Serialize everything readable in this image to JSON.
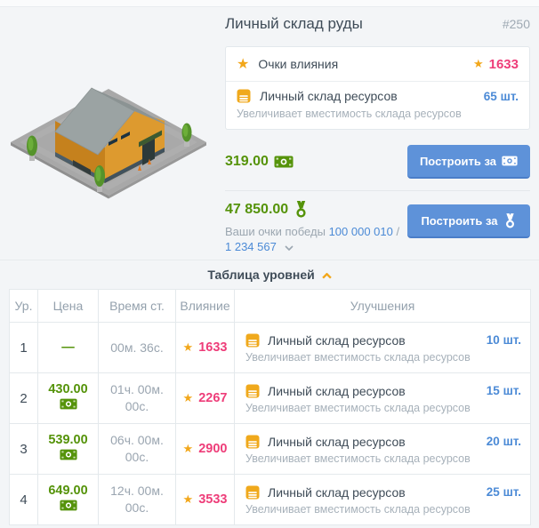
{
  "colors": {
    "accent_blue": "#5e92d9",
    "link_blue": "#4b8ad6",
    "money_green": "#55930a",
    "influence_pink": "#ee3d79",
    "gold": "#f2a71b",
    "gray_text": "#9ba6b0",
    "dark_text": "#3f4c58",
    "background": "#f3f5f7"
  },
  "header": {
    "title": "Личный склад руды",
    "building_number": "#250"
  },
  "info_box": {
    "influence": {
      "label": "Очки влияния",
      "value": "1633"
    },
    "storage": {
      "label": "Личный склад ресурсов",
      "count": "65 шт.",
      "description": "Увеличивает вместимость склада ресурсов"
    }
  },
  "purchase": {
    "money": {
      "price": "319.00",
      "button_label": "Построить за"
    },
    "medals": {
      "price": "47 850.00",
      "button_label": "Построить за",
      "victory_points_label": "Ваши очки победы",
      "victory_points_current": "100 000 010",
      "separator": "/",
      "victory_points_required": "1 234 567"
    }
  },
  "levels_section": {
    "title": "Таблица уровней",
    "columns": [
      "Ур.",
      "Цена",
      "Время ст.",
      "Влияние",
      "Улучшения"
    ],
    "rows": [
      {
        "level": "1",
        "price": "—",
        "price_icon": false,
        "time": "00м. 36с.",
        "influence": "1633",
        "upgrade_name": "Личный склад ресурсов",
        "upgrade_count": "10 шт.",
        "upgrade_desc": "Увеличивает вместимость склада ресурсов"
      },
      {
        "level": "2",
        "price": "430.00",
        "price_icon": true,
        "time": "01ч. 00м. 00с.",
        "influence": "2267",
        "upgrade_name": "Личный склад ресурсов",
        "upgrade_count": "15 шт.",
        "upgrade_desc": "Увеличивает вместимость склада ресурсов"
      },
      {
        "level": "3",
        "price": "539.00",
        "price_icon": true,
        "time": "06ч. 00м. 00с.",
        "influence": "2900",
        "upgrade_name": "Личный склад ресурсов",
        "upgrade_count": "20 шт.",
        "upgrade_desc": "Увеличивает вместимость склада ресурсов"
      },
      {
        "level": "4",
        "price": "649.00",
        "price_icon": true,
        "time": "12ч. 00м. 00с.",
        "influence": "3533",
        "upgrade_name": "Личный склад ресурсов",
        "upgrade_count": "25 шт.",
        "upgrade_desc": "Увеличивает вместимость склада ресурсов"
      }
    ]
  }
}
